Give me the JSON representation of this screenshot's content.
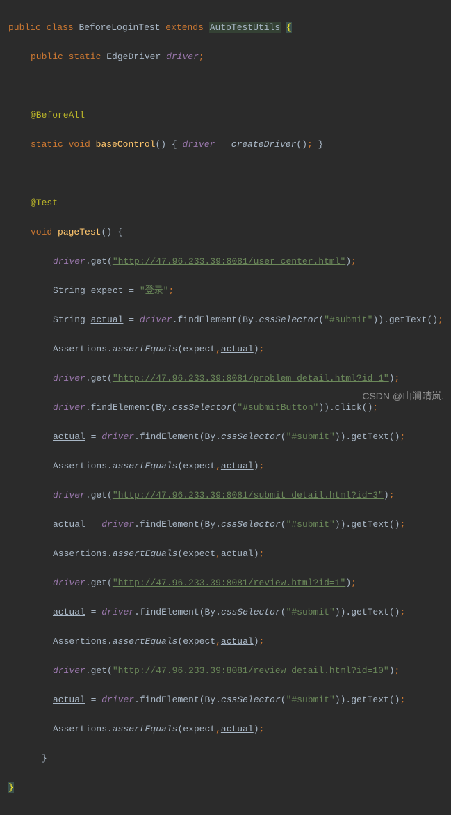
{
  "keywords": {
    "public": "public",
    "class": "class",
    "extends": "extends",
    "static": "static",
    "void": "void"
  },
  "className": "BeforeLoginTest",
  "extendsName": "AutoTestUtils",
  "driverType": "EdgeDriver",
  "driverField": "driver",
  "annotations": {
    "beforeAll": "@BeforeAll",
    "test": "@Test"
  },
  "methods": {
    "baseControl": "baseControl",
    "pageTest": "pageTest",
    "createDriver": "createDriver",
    "get": "get",
    "findElement": "findElement",
    "cssSelector": "cssSelector",
    "getText": "getText",
    "click": "click",
    "assertEquals": "assertEquals"
  },
  "classes": {
    "By": "By",
    "Assertions": "Assertions"
  },
  "vars": {
    "expect": "expect",
    "actual": "actual",
    "stringType": "String"
  },
  "strings": {
    "loginText": "\"登录\"",
    "submitSel": "\"#submit\"",
    "submitButtonSel": "\"#submitButton\"",
    "url1": "\"http://47.96.233.39:8081/user_center.html\"",
    "url2": "\"http://47.96.233.39:8081/problem_detail.html?id=1\"",
    "url3": "\"http://47.96.233.39:8081/submit_detail.html?id=3\"",
    "url4": "\"http://47.96.233.39:8081/review.html?id=1\"",
    "url5": "\"http://47.96.233.39:8081/review_detail.html?id=10\""
  },
  "watermark": "CSDN @山涧晴岚."
}
